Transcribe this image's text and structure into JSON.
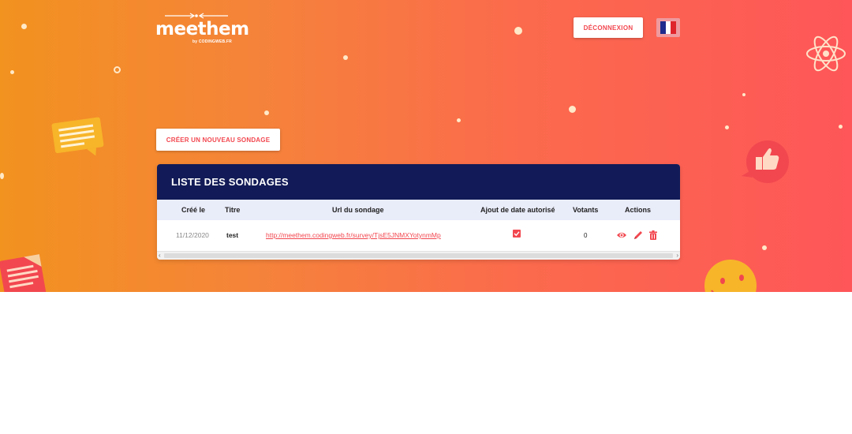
{
  "header": {
    "logo_text": "meethem",
    "logo_subtext": "by CODINGWEB.FR",
    "logout_label": "DÉCONNEXION",
    "language_flag": "french-flag-icon"
  },
  "actions": {
    "create_survey_label": "CRÉER UN NOUVEAU SONDAGE"
  },
  "surveys": {
    "title": "LISTE DES SONDAGES",
    "columns": [
      "Créé le",
      "Titre",
      "Url du sondage",
      "Ajout de date autorisé",
      "Votants",
      "Actions"
    ],
    "rows": [
      {
        "created": "11/12/2020",
        "title": "test",
        "url": "http://meethem.codingweb.fr/survey/TjsE5JNMXYotynmMp",
        "date_add_allowed": true,
        "voters": "0",
        "actions": [
          "eye-icon",
          "pencil-icon",
          "trash-icon"
        ]
      }
    ]
  },
  "colors": {
    "accent": "#f2474f",
    "header_navy": "#121b57",
    "gradient_start": "#f2921f",
    "gradient_end": "#fe5659"
  }
}
